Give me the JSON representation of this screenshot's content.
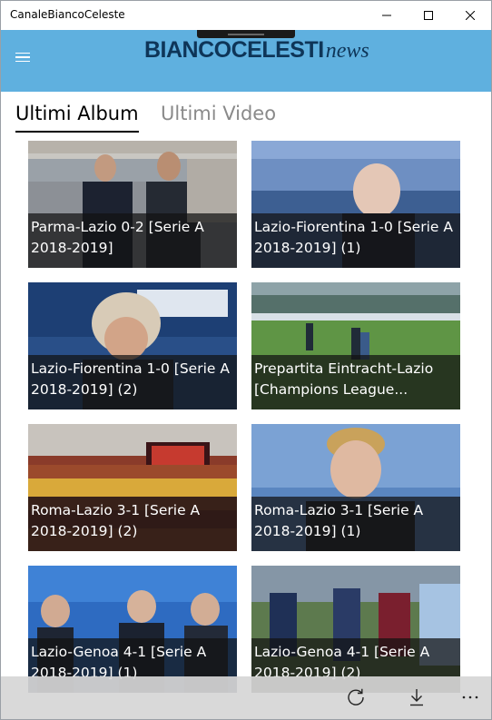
{
  "window": {
    "title": "CanaleBiancoCeleste"
  },
  "header": {
    "logo_main": "BIANCOCELESTI",
    "logo_sub": "news"
  },
  "tabs": [
    {
      "label": "Ultimi Album"
    },
    {
      "label": "Ultimi Video"
    }
  ],
  "albums": [
    {
      "title": "Parma-Lazio 0-2 [Serie A 2018-2019]"
    },
    {
      "title": "Lazio-Fiorentina 1-0 [Serie A 2018-2019] (1)"
    },
    {
      "title": "Lazio-Fiorentina 1-0 [Serie A 2018-2019] (2)"
    },
    {
      "title": "Prepartita Eintracht-Lazio [Champions League..."
    },
    {
      "title": "Roma-Lazio 3-1 [Serie A 2018-2019] (2)"
    },
    {
      "title": "Roma-Lazio 3-1 [Serie A 2018-2019] (1)"
    },
    {
      "title": "Lazio-Genoa 4-1 [Serie A 2018-2019] (1)"
    },
    {
      "title": "Lazio-Genoa 4-1 [Serie A 2018-2019] (2)"
    }
  ],
  "appbar": {
    "icons": [
      "refresh-icon",
      "download-icon",
      "more-icon"
    ]
  },
  "colors": {
    "header_bg": "#5fb0df",
    "logo": "#0e3558",
    "caption_bg": "#121212"
  }
}
